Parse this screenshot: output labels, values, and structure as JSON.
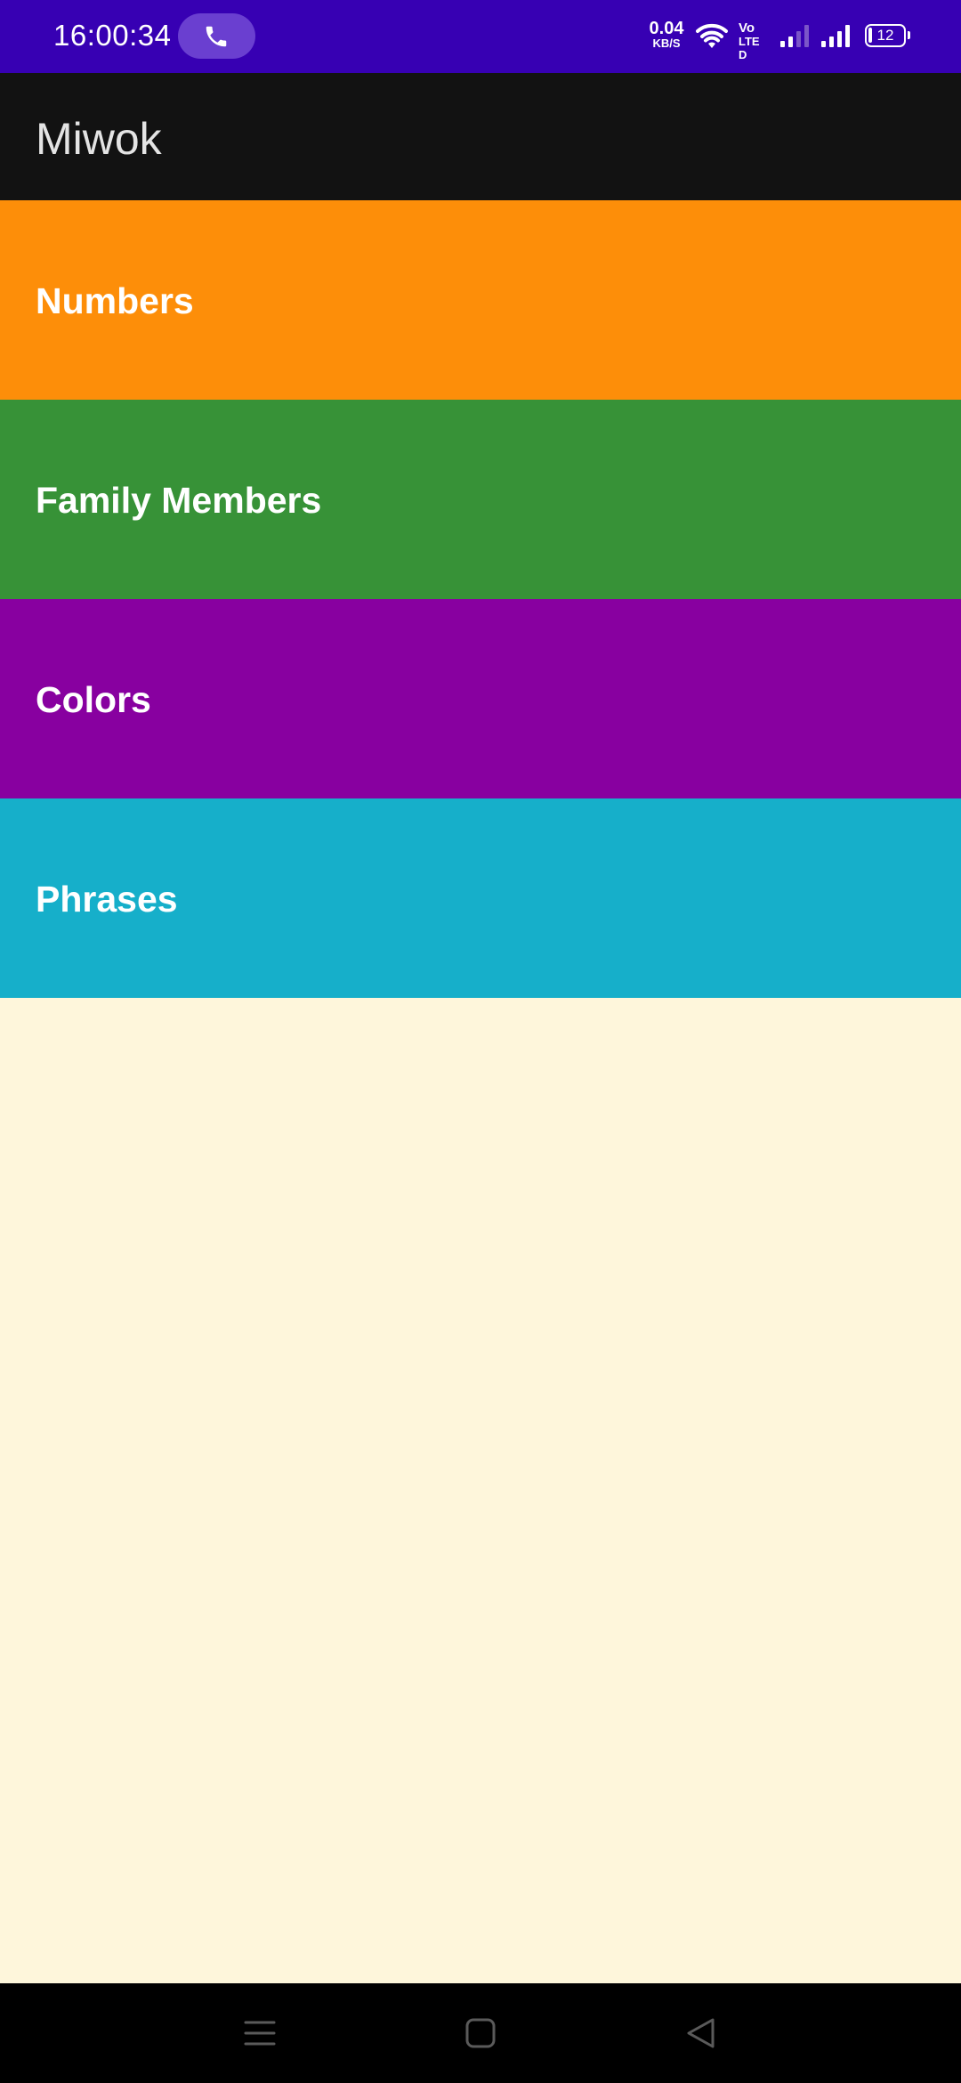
{
  "status_bar": {
    "time": "16:00:34",
    "net_speed_value": "0.04",
    "net_speed_unit": "KB/S",
    "volte_top": "Vo",
    "volte_bottom": "LTE D",
    "battery_level": "12",
    "icons": [
      "call-icon",
      "wifi-icon",
      "signal-icon",
      "battery-icon"
    ]
  },
  "app_bar": {
    "title": "Miwok"
  },
  "categories": [
    {
      "label": "Numbers",
      "color": "#FD8E09"
    },
    {
      "label": "Family Members",
      "color": "#379237"
    },
    {
      "label": "Colors",
      "color": "#8800A0"
    },
    {
      "label": "Phrases",
      "color": "#16AFCA"
    }
  ],
  "colors": {
    "status_bar": "#3700B3",
    "app_bar": "#121212",
    "background": "#FEF6DB",
    "nav_bar": "#000000"
  },
  "nav_bar": {
    "icons": [
      "menu-icon",
      "home-icon",
      "back-icon"
    ]
  }
}
